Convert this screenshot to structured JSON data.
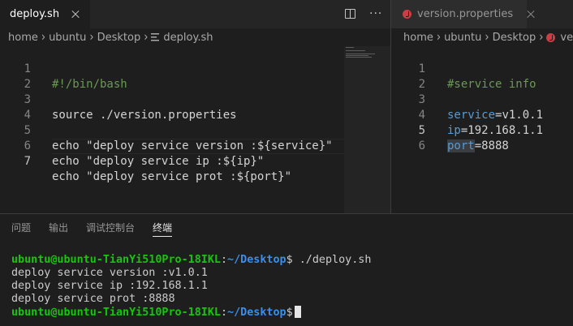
{
  "left_editor": {
    "tab": {
      "label": "deploy.sh",
      "close_icon": "close-icon"
    },
    "actions": {
      "split_icon": "split-editor-icon",
      "more_label": "···"
    },
    "breadcrumb": [
      "home",
      "ubuntu",
      "Desktop",
      "deploy.sh"
    ],
    "lines": [
      {
        "number": "1",
        "text": "#!/bin/bash"
      },
      {
        "number": "2",
        "text": ""
      },
      {
        "number": "3",
        "text": "source ./version.properties"
      },
      {
        "number": "4",
        "text": ""
      },
      {
        "number": "5",
        "text": "echo \"deploy service version :${service}\""
      },
      {
        "number": "6",
        "text": "echo \"deploy service ip :${ip}\""
      },
      {
        "number": "7",
        "text": "echo \"deploy service prot :${port}\""
      }
    ]
  },
  "right_editor": {
    "tab": {
      "label": "version.properties",
      "icon": "ruby-icon",
      "close_icon": "close-icon"
    },
    "breadcrumb": [
      "home",
      "ubuntu",
      "Desktop",
      "ve"
    ],
    "lines": [
      {
        "number": "1",
        "comment": "#service info"
      },
      {
        "number": "2"
      },
      {
        "number": "3",
        "key": "service",
        "value": "=v1.0.1"
      },
      {
        "number": "4",
        "key": "ip",
        "value": "=192.168.1.1"
      },
      {
        "number": "5",
        "key": "port",
        "value": "=8888"
      },
      {
        "number": "6"
      }
    ]
  },
  "panel": {
    "tabs": [
      "问题",
      "输出",
      "调试控制台",
      "终端"
    ],
    "active_tab": "终端"
  },
  "terminal": {
    "prompt_user": "ubuntu@ubuntu-TianYi510Pro-18IKL",
    "prompt_colon": ":",
    "prompt_path": "~/Desktop",
    "prompt_dollar": "$",
    "command": " ./deploy.sh",
    "output": [
      "deploy service version :v1.0.1",
      "deploy service ip :192.168.1.1",
      "deploy service prot :8888"
    ]
  },
  "colors": {
    "background": "#1e1e1e",
    "tabbar": "#252526",
    "comment": "#6a9955",
    "keyword": "#569cd6",
    "prompt_user": "#16c60c",
    "prompt_path": "#3b8eea"
  }
}
